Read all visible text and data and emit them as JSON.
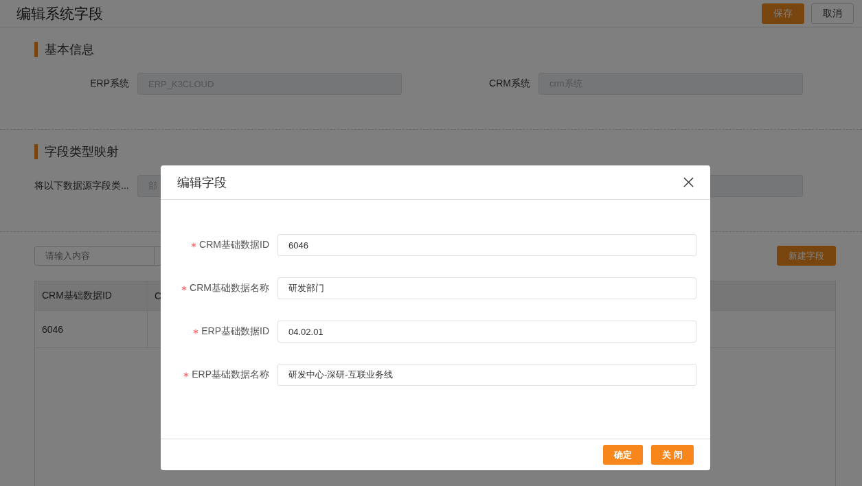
{
  "header": {
    "title": "编辑系统字段",
    "buttons": [
      {
        "label": "保存",
        "kind": "primary"
      },
      {
        "label": "取消",
        "kind": "default"
      }
    ]
  },
  "sections": [
    {
      "title": "基本信息",
      "fields": [
        {
          "label": "ERP系统",
          "value": "ERP_K3CLOUD",
          "disabled": true
        },
        {
          "label": "CRM系统",
          "value": "crm系统",
          "disabled": true
        }
      ]
    },
    {
      "title": "字段类型映射",
      "fields": [
        {
          "label": "将以下数据源字段类...",
          "value": "部",
          "disabled": true
        },
        {
          "disabled": true
        }
      ]
    }
  ],
  "toolbar": {
    "search": {
      "placeholder": "请输入内容"
    },
    "new_button": "新建字段"
  },
  "table": {
    "columns": [
      "CRM基础数据ID",
      "C"
    ],
    "rows": [
      [
        "6046"
      ]
    ]
  },
  "dialog": {
    "title": "编辑字段",
    "fields": [
      {
        "label": "CRM基础数据ID",
        "required": true,
        "value": "6046"
      },
      {
        "label": "CRM基础数据名称",
        "required": true,
        "value": "研发部门"
      },
      {
        "label": "ERP基础数据ID",
        "required": true,
        "value": "04.02.01"
      },
      {
        "label": "ERP基础数据名称",
        "required": true,
        "value": "研发中心-深研-互联业务线"
      }
    ],
    "buttons": [
      {
        "label": "确定"
      },
      {
        "label": "关 闭"
      }
    ]
  }
}
